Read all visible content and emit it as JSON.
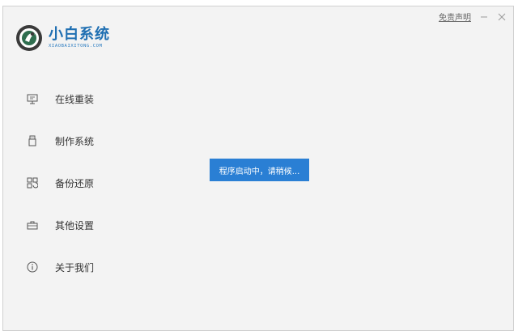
{
  "header": {
    "disclaimer_label": "免责声明",
    "minimize_icon": "minimize-icon",
    "close_icon": "close-icon"
  },
  "logo": {
    "title": "小白系统",
    "subtitle": "XIAOBAIXITONG.COM",
    "icon": "xiaobai-logo-icon",
    "colors": {
      "brand": "#1f6fb2",
      "brand_dark": "#333333"
    }
  },
  "sidebar": {
    "items": [
      {
        "label": "在线重装",
        "icon": "monitor-icon"
      },
      {
        "label": "制作系统",
        "icon": "usb-drive-icon"
      },
      {
        "label": "备份还原",
        "icon": "backup-grid-icon"
      },
      {
        "label": "其他设置",
        "icon": "toolbox-icon"
      },
      {
        "label": "关于我们",
        "icon": "info-icon"
      }
    ]
  },
  "status": {
    "loading_text": "程序启动中，请稍候...",
    "color": "#2a7fd4"
  }
}
